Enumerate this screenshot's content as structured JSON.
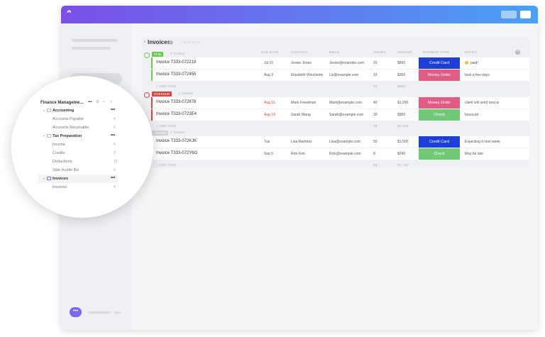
{
  "list": {
    "title": "Invoices",
    "new_task": "+ NEW TASK",
    "add_task": "+ ADD TASK",
    "columns": [
      "DUE DATE",
      "CONTACT",
      "EMAIL",
      "HOURS",
      "AMOUNT",
      "PAYMENT TYPE",
      "NOTES"
    ],
    "groups": [
      {
        "status": "PAID",
        "count": "2 TASKS",
        "color": "#6bc950",
        "hours_total": "30",
        "amount_total": "$900",
        "rows": [
          {
            "name": "Invoice T333-072219",
            "due": "Jul 31",
            "contact": "Jessie Jones",
            "email": "Jessie@example.com",
            "hours": "20",
            "amount": "$600",
            "payment": "Credit Card",
            "pay_color": "#1d3fd8",
            "notes": "paid!",
            "overdue": false
          },
          {
            "name": "Invoice T333-072455",
            "due": "Aug 2",
            "contact": "Elizabeth Wincheste",
            "email": "Liz@example.com",
            "hours": "10",
            "amount": "$300",
            "payment": "Money Order",
            "pay_color": "#e05c84",
            "notes": "took a few days",
            "overdue": false
          }
        ]
      },
      {
        "status": "OVERDUE",
        "count": "2 TASKS",
        "color": "#d9453b",
        "hours_total": "70",
        "amount_total": "$2,100",
        "rows": [
          {
            "name": "Invoice T333-072678",
            "due": "Aug 15",
            "contact": "Mark Freedman",
            "email": "Mark@example.com",
            "hours": "40",
            "amount": "$1,200",
            "payment": "Money Order",
            "pay_color": "#e05c84",
            "notes": "client will send next w",
            "overdue": true
          },
          {
            "name": "Invoice T333-0723E4",
            "due": "Aug 19",
            "contact": "Sarah Wang",
            "email": "Sarah@example.com",
            "hours": "30",
            "amount": "$900",
            "payment": "Check",
            "pay_color": "#71c876",
            "notes": "bounced",
            "overdue": true
          }
        ]
      },
      {
        "status": "UNPAID",
        "count": "2 TASKS",
        "color": "#d0d2d6",
        "hours_total": "58",
        "amount_total": "$1,740",
        "rows": [
          {
            "name": "Invoice T333-072KJK",
            "due": "Tue",
            "contact": "Lisa Martinez",
            "email": "Lisa@example.com",
            "hours": "50",
            "amount": "$1,500",
            "payment": "Credit Card",
            "pay_color": "#1d3fd8",
            "notes": "Expecting it next week",
            "overdue": false
          },
          {
            "name": "Invoice T333-072Y6G",
            "due": "Sep 5",
            "contact": "Rick Kim",
            "email": "Rick@example.com",
            "hours": "8",
            "amount": "$240",
            "payment": "Check",
            "pay_color": "#71c876",
            "notes": "May be late",
            "overdue": false
          }
        ]
      }
    ]
  },
  "sidebar": {
    "space": "Finance Manageme...",
    "items": [
      {
        "label": "Accounting",
        "folder": true
      },
      {
        "label": "Accounts Payable",
        "count": "4"
      },
      {
        "label": "Accounts Receivable",
        "count": "6"
      },
      {
        "label": "Tax Preparation",
        "folder": true
      },
      {
        "label": "Income",
        "count": "4"
      },
      {
        "label": "Credits",
        "count": "3"
      },
      {
        "label": "Deductions",
        "count": "10"
      },
      {
        "label": "Side Hustle Biz",
        "count": "6"
      },
      {
        "label": "Invoices",
        "folder": true,
        "active": true
      },
      {
        "label": "Invoices",
        "count": "4"
      }
    ]
  }
}
